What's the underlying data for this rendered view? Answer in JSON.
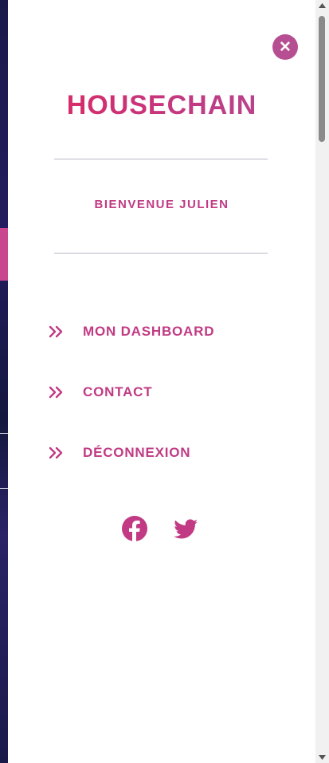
{
  "brand": {
    "name": "HOUSECHAIN"
  },
  "welcome": {
    "text": "BIENVENUE JULIEN"
  },
  "close": {
    "symbol": "✕",
    "icon": "close-icon"
  },
  "menu": [
    {
      "label": "MON DASHBOARD",
      "icon": "double-chevron-right-icon"
    },
    {
      "label": "CONTACT",
      "icon": "double-chevron-right-icon"
    },
    {
      "label": "DÉCONNEXION",
      "icon": "double-chevron-right-icon"
    }
  ],
  "social": [
    {
      "name": "facebook-icon"
    },
    {
      "name": "twitter-icon"
    }
  ],
  "colors": {
    "accent": "#c13a83",
    "brand_gradient_start": "#e0245e",
    "close_bg": "#b64f92",
    "rule": "#b9b9c8"
  }
}
